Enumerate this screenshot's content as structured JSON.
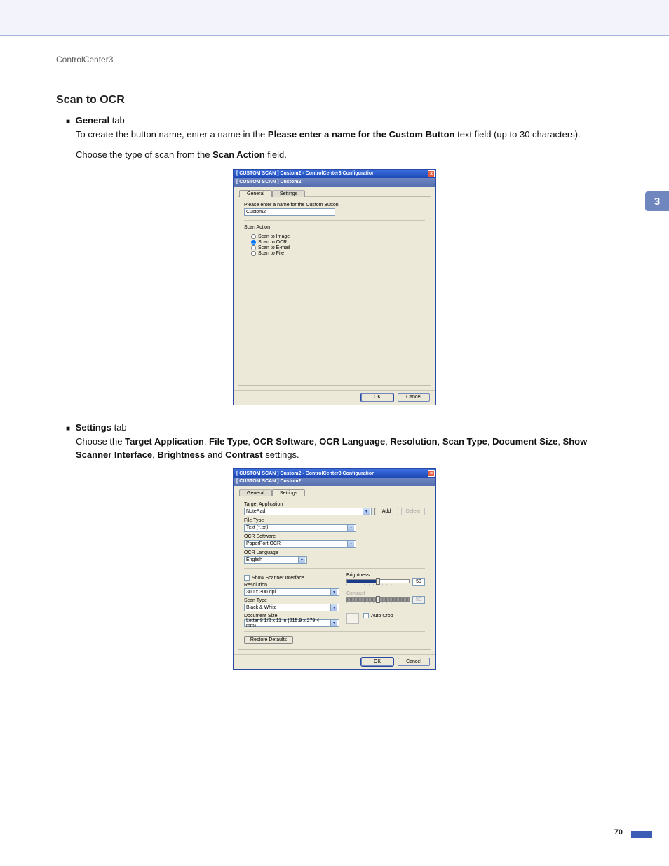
{
  "breadcrumb": "ControlCenter3",
  "heading": "Scan to OCR",
  "bullets": {
    "general_label_bold": "General",
    "general_label_rest": " tab",
    "settings_label_bold": "Settings",
    "settings_label_rest": " tab"
  },
  "paragraphs": {
    "p1a": "To create the button name, enter a name in the ",
    "p1_bold": "Please enter a name for the Custom Button",
    "p1b": " text field (up to 30 characters).",
    "p2a": "Choose the type of scan from the ",
    "p2_bold": "Scan Action",
    "p2b": " field.",
    "p3a": "Choose the ",
    "p3_bolds": [
      "Target Application",
      "File Type",
      "OCR Software",
      "OCR Language",
      "Resolution",
      "Scan Type",
      "Document Size",
      "Show Scanner Interface",
      "Brightness",
      "Contrast"
    ],
    "p3_joins": [
      ", ",
      ", ",
      ", ",
      ", ",
      ", ",
      ", ",
      ", ",
      ", ",
      " and "
    ],
    "p3b": " settings."
  },
  "sidebar_num": "3",
  "page_number": "70",
  "dlg1": {
    "title": "[  CUSTOM SCAN  ]   Custom2 - ControlCenter3 Configuration",
    "subtitle": "[  CUSTOM SCAN  ]    Custom2",
    "tab_general": "General",
    "tab_settings": "Settings",
    "name_label": "Please enter a name for the Custom Button",
    "name_value": "Custom2",
    "scan_action_label": "Scan Action",
    "radio1": "Scan to Image",
    "radio2": "Scan to OCR",
    "radio3": "Scan to E-mail",
    "radio4": "Scan to File",
    "ok": "OK",
    "cancel": "Cancel"
  },
  "dlg2": {
    "title": "[  CUSTOM SCAN  ]   Custom2 - ControlCenter3 Configuration",
    "subtitle": "[  CUSTOM SCAN  ]    Custom2",
    "tab_general": "General",
    "tab_settings": "Settings",
    "target_label": "Target Application",
    "target_value": "NotePad",
    "add": "Add",
    "delete": "Delete",
    "filetype_label": "File Type",
    "filetype_value": "Text (*.txt)",
    "ocrsoft_label": "OCR Software",
    "ocrsoft_value": "PaperPort OCR",
    "ocrlang_label": "OCR Language",
    "ocrlang_value": "English",
    "show_scanner": "Show Scanner Interface",
    "resolution_label": "Resolution",
    "resolution_value": "300 x 300 dpi",
    "scantype_label": "Scan Type",
    "scantype_value": "Black & White",
    "docsize_label": "Document Size",
    "docsize_value": "Letter 8 1/2 x 11 in (215.9 x 279.4 mm)",
    "brightness_label": "Brightness",
    "brightness_value": "50",
    "contrast_label": "Contrast",
    "contrast_value": "50",
    "autocrop": "Auto Crop",
    "restore": "Restore Defaults",
    "ok": "OK",
    "cancel": "Cancel"
  }
}
